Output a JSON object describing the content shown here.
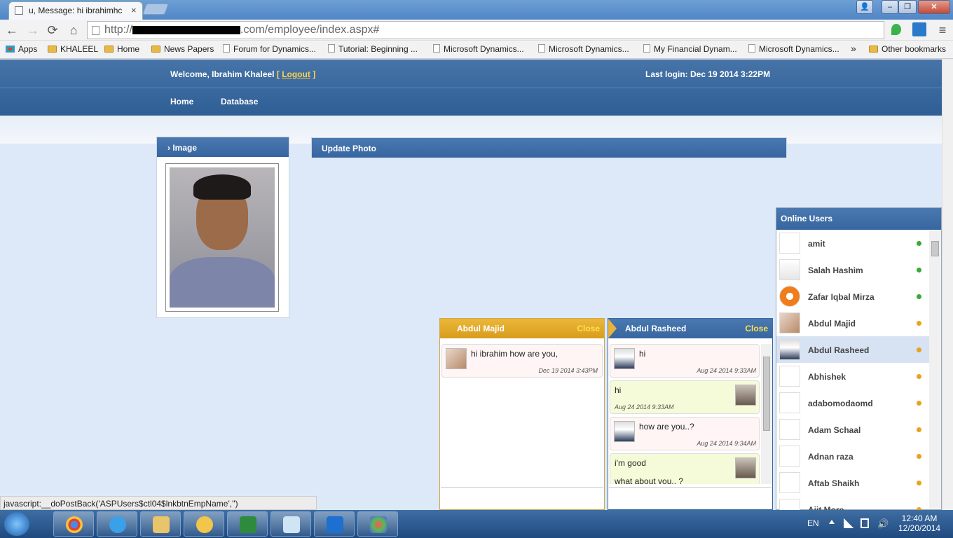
{
  "browser": {
    "tab_title": "u,   Message: hi ibrahimhc",
    "tab_close": "×",
    "url_prefix": "http://",
    "url_suffix": ".com/employee/index.aspx#",
    "window_buttons": {
      "user": "👤",
      "minimize": "–",
      "maximize": "❐",
      "close": "✕"
    },
    "nav": {
      "back": "←",
      "forward": "→",
      "reload": "⟳",
      "home": "⌂"
    },
    "menu_icon": "≡",
    "bookmarks": [
      "Apps",
      "KHALEEL",
      "Home",
      "News Papers",
      "Forum for Dynamics...",
      "Tutorial: Beginning ...",
      "Microsoft Dynamics...",
      "Microsoft Dynamics...",
      "My Financial Dynam...",
      "Microsoft Dynamics..."
    ],
    "bookmarks_more": "»",
    "other_bookmarks": "Other bookmarks"
  },
  "header": {
    "welcome": "Welcome, Ibrahim Khaleel",
    "logout_open": "[",
    "logout": "Logout",
    "logout_close": "]",
    "last_login": "Last login: Dec 19 2014 3:22PM",
    "menu": [
      "Home",
      "Database"
    ]
  },
  "image_panel": {
    "title": "› Image"
  },
  "update_panel": {
    "title": "Update Photo"
  },
  "online": {
    "title": "Online Users",
    "users": [
      {
        "name": "amit",
        "status": "green"
      },
      {
        "name": "Salah Hashim",
        "status": "green"
      },
      {
        "name": "Zafar Iqbal Mirza",
        "status": "green"
      },
      {
        "name": "Abdul Majid",
        "status": "orange"
      },
      {
        "name": "Abdul Rasheed",
        "status": "orange"
      },
      {
        "name": "Abhishek",
        "status": "orange"
      },
      {
        "name": "adabomodaomd",
        "status": "orange"
      },
      {
        "name": "Adam Schaal",
        "status": "orange"
      },
      {
        "name": "Adnan raza",
        "status": "orange"
      },
      {
        "name": "Aftab Shaikh",
        "status": "orange"
      },
      {
        "name": "Ajit More",
        "status": "orange"
      }
    ],
    "colors": {
      "green": "#3aa83a",
      "orange": "#e9a21a"
    }
  },
  "chat1": {
    "name": "Abdul Majid",
    "close": "Close",
    "messages": [
      {
        "text": "hi ibrahim how are you,",
        "time": "Dec 19 2014 3:43PM"
      }
    ]
  },
  "chat2": {
    "name": "Abdul Rasheed",
    "close": "Close",
    "messages": [
      {
        "text": "hi",
        "time": "Aug 24 2014 9:33AM"
      },
      {
        "text": "hi",
        "time": "Aug 24 2014 9:33AM"
      },
      {
        "text": "how are you..?",
        "time": "Aug 24 2014 9:34AM"
      },
      {
        "text": "i'm good",
        "text2": "what about you.. ?"
      }
    ]
  },
  "statusbar": "javascript:__doPostBack('ASPUsers$ctl04$lnkbtnEmpName','')",
  "tray": {
    "lang": "EN",
    "time": "12:40 AM",
    "date": "12/20/2014"
  }
}
